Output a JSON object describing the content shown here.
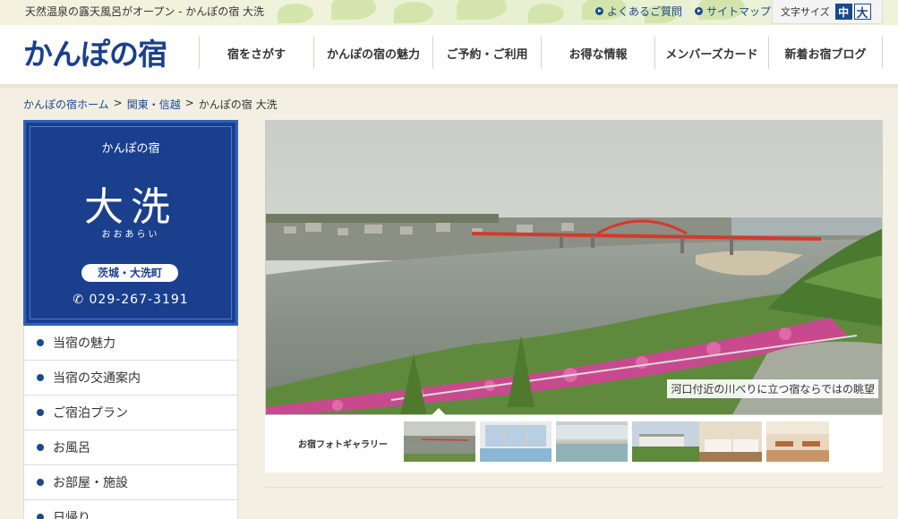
{
  "topbar": {
    "tagline": "天然温泉の露天風呂がオープン - かんぽの宿 大洗",
    "links": [
      {
        "label": "よくあるご質問",
        "icon": "arrow-circle-icon"
      },
      {
        "label": "サイトマップ",
        "icon": "arrow-circle-icon"
      }
    ],
    "font_size": {
      "label": "文字サイズ",
      "medium": "中",
      "large": "大"
    }
  },
  "header": {
    "logo": "かんぽの宿",
    "nav": [
      "宿をさがす",
      "かんぽの宿の魅力",
      "ご予約・ご利用",
      "お得な情報",
      "メンバーズカード",
      "新着お宿ブログ"
    ]
  },
  "breadcrumb": [
    {
      "label": "かんぽの宿ホーム",
      "link": true
    },
    {
      "label": "関東・信越",
      "link": true
    },
    {
      "label": "かんぽの宿 大洗",
      "link": false
    }
  ],
  "hotel_card": {
    "brand": "かんぽの宿",
    "name": "大洗",
    "reading": "おおあらい",
    "location": "茨城・大洗町",
    "phone": "029-267-3191",
    "color": "#1a3f8c"
  },
  "side_menu": [
    "当宿の魅力",
    "当宿の交通案内",
    "ご宿泊プラン",
    "お風呂",
    "お部屋・施設",
    "日帰り"
  ],
  "main_photo": {
    "caption": "河口付近の川べりに立つ宿ならではの眺望"
  },
  "gallery": {
    "label": "お宿フォトギャラリー",
    "thumbs": [
      "bridge-view",
      "bath-window",
      "indoor-bath",
      "hotel-building",
      "guest-room",
      "restaurant"
    ]
  },
  "colors": {
    "accent": "#1a3f8c",
    "link": "#1a4a8a",
    "background": "#f3efe2"
  }
}
